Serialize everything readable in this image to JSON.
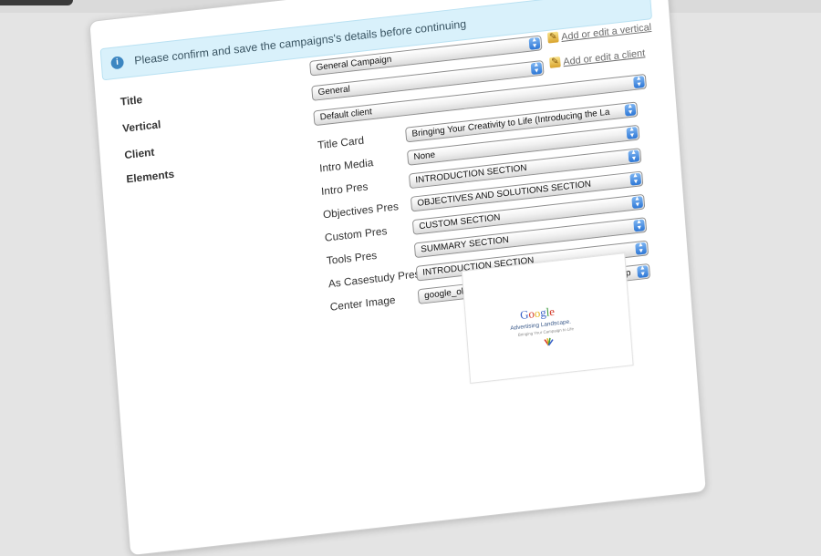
{
  "notice": {
    "icon": "info-icon",
    "message": "Please confirm and save the campaigns's details before continuing"
  },
  "labels": {
    "title": "Title",
    "vertical": "Vertical",
    "client": "Client",
    "elements": "Elements"
  },
  "title_select": {
    "value": "General Campaign"
  },
  "vertical_select": {
    "value": "General"
  },
  "client_select": {
    "value": "Default client"
  },
  "links": {
    "vertical": "Add or edit a vertical",
    "client": "Add or edit a client"
  },
  "elements": [
    {
      "label": "Title Card",
      "value": "Bringing Your Creativity to Life (Introducing the La"
    },
    {
      "label": "Intro Media",
      "value": "None"
    },
    {
      "label": "Intro Pres",
      "value": "INTRODUCTION SECTION"
    },
    {
      "label": "Objectives Pres",
      "value": "OBJECTIVES AND SOLUTIONS SECTION"
    },
    {
      "label": "Custom Pres",
      "value": "CUSTOM SECTION"
    },
    {
      "label": "Tools Pres",
      "value": "SUMMARY SECTION"
    },
    {
      "label": "As Casestudy Pres",
      "value": "INTRODUCTION SECTION"
    },
    {
      "label": "Center Image",
      "value": "google_olgilvyCreativeLandscape_centre_image4.p"
    }
  ],
  "preview": {
    "logo_letters": [
      "G",
      "o",
      "o",
      "g",
      "l",
      "e"
    ],
    "logo_colors": [
      "#3a62c8",
      "#d43b2b",
      "#e7b623",
      "#3a62c8",
      "#3c9a3c",
      "#d43b2b"
    ],
    "line1": "Advertising Landscape.",
    "line2": "Bringing Your Campaign to Life"
  },
  "colors": {
    "accent": "#2d77d6",
    "notice_bg": "#d9f1fb"
  }
}
